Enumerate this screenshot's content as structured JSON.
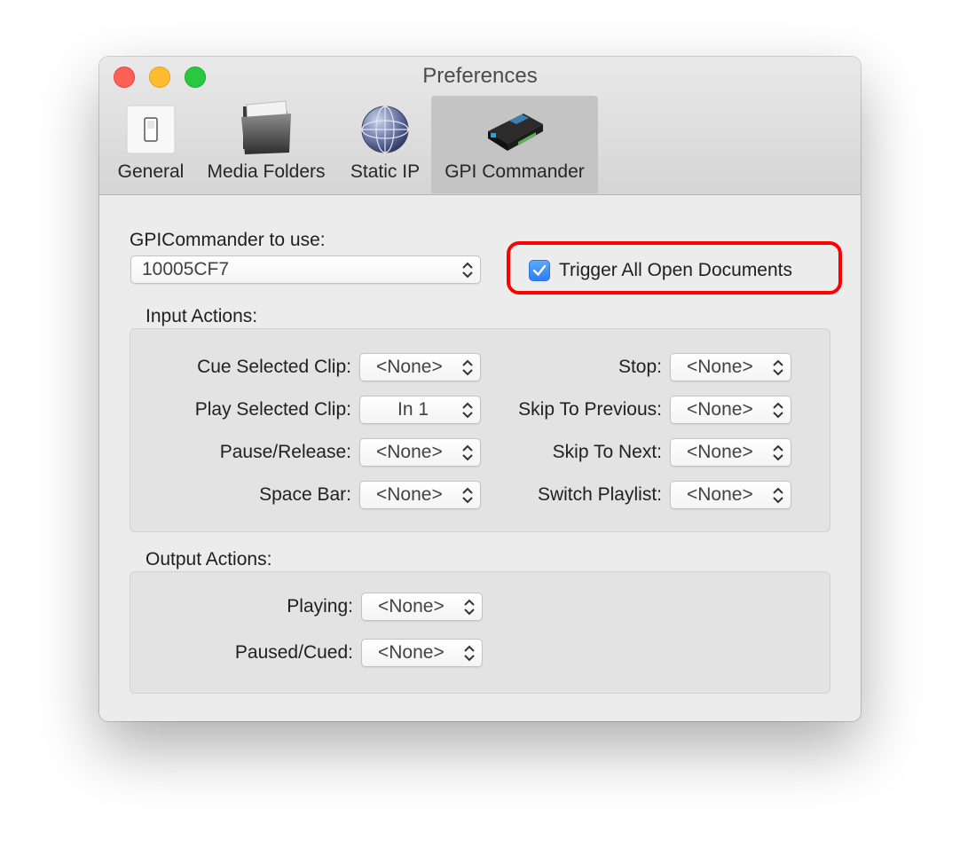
{
  "window": {
    "title": "Preferences"
  },
  "tabs": [
    {
      "label": "General",
      "icon": "light-switch-icon",
      "selected": false
    },
    {
      "label": "Media Folders",
      "icon": "folder-icon",
      "selected": false
    },
    {
      "label": "Static IP",
      "icon": "network-globe-icon",
      "selected": false
    },
    {
      "label": "GPI Commander",
      "icon": "gpi-device-icon",
      "selected": true
    }
  ],
  "device": {
    "label": "GPICommander to use:",
    "selected": "10005CF7"
  },
  "trigger_all": {
    "label": "Trigger All Open Documents",
    "checked": true,
    "highlight_color": "#ff0000"
  },
  "input_actions": {
    "title": "Input Actions:",
    "rows": [
      {
        "label": "Cue Selected Clip:",
        "value": "<None>"
      },
      {
        "label": "Play Selected Clip:",
        "value": "In 1"
      },
      {
        "label": "Pause/Release:",
        "value": "<None>"
      },
      {
        "label": "Space Bar:",
        "value": "<None>"
      },
      {
        "label": "Stop:",
        "value": "<None>"
      },
      {
        "label": "Skip To Previous:",
        "value": "<None>"
      },
      {
        "label": "Skip To Next:",
        "value": "<None>"
      },
      {
        "label": "Switch Playlist:",
        "value": "<None>"
      }
    ]
  },
  "output_actions": {
    "title": "Output Actions:",
    "rows": [
      {
        "label": "Playing:",
        "value": "<None>"
      },
      {
        "label": "Paused/Cued:",
        "value": "<None>"
      }
    ]
  },
  "colors": {
    "accent": "#2e7ef6",
    "close": "#fe5f57",
    "minimize": "#febc2e",
    "maximize": "#28c840"
  }
}
